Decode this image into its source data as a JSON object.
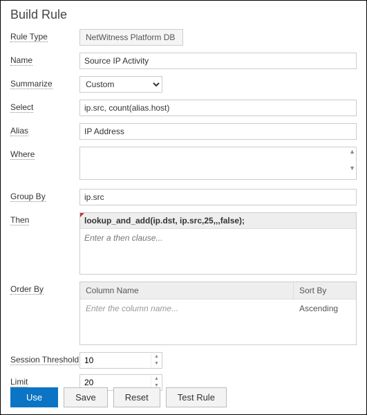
{
  "title": "Build Rule",
  "labels": {
    "ruleType": "Rule Type",
    "name": "Name",
    "summarize": "Summarize",
    "select": "Select",
    "alias": "Alias",
    "where": "Where",
    "groupBy": "Group By",
    "then": "Then",
    "orderBy": "Order By",
    "sessionThreshold": "Session Threshold",
    "limit": "Limit"
  },
  "values": {
    "ruleType": "NetWitness Platform DB",
    "name": "Source IP Activity",
    "summarize": "Custom",
    "select": "ip.src, count(alias.host)",
    "alias": "IP Address",
    "where": "",
    "groupBy": "ip.src",
    "thenHeader": "lookup_and_add(ip.dst, ip.src,25,,,false);",
    "thenPlaceholder": "Enter a then clause...",
    "sessionThreshold": "10",
    "limit": "20"
  },
  "orderBy": {
    "headers": {
      "col1": "Column Name",
      "col2": "Sort By"
    },
    "row": {
      "placeholder": "Enter the column name...",
      "sort": "Ascending"
    }
  },
  "buttons": {
    "use": "Use",
    "save": "Save",
    "reset": "Reset",
    "testRule": "Test Rule"
  }
}
